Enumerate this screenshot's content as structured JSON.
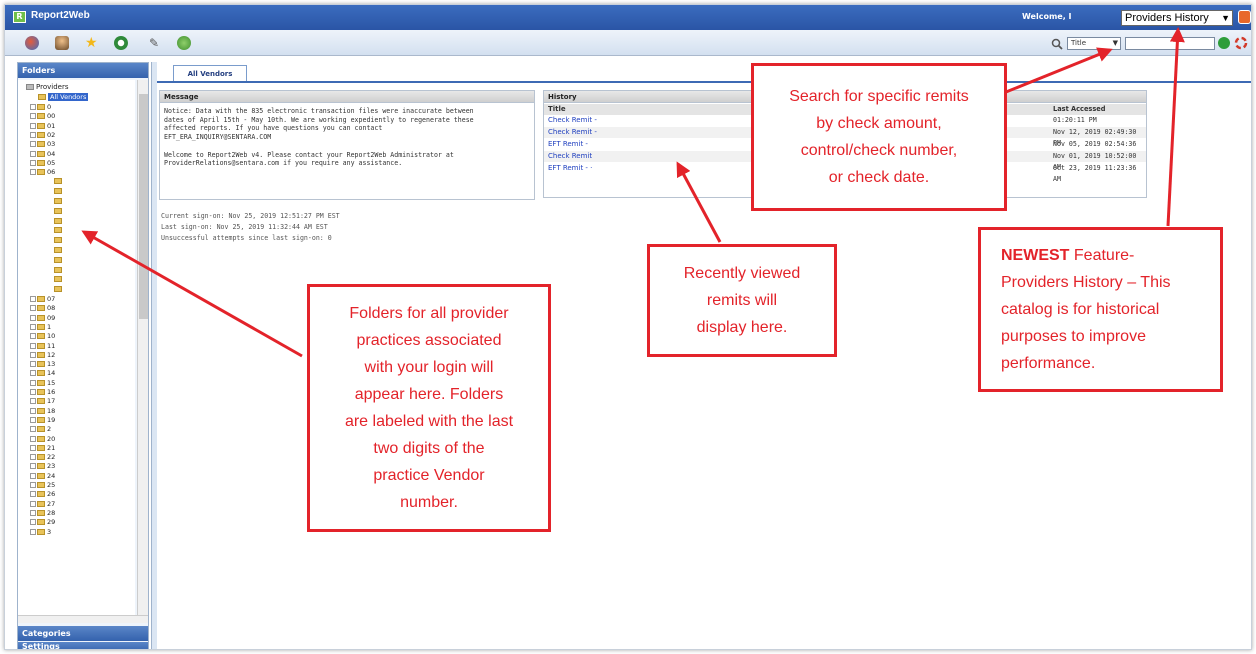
{
  "app": {
    "title": "Report2Web",
    "welcome": "Welcome, I",
    "catalog_select": "Providers History"
  },
  "toolbar": {
    "search_type": "Title",
    "search_value": ""
  },
  "leftpane": {
    "folders_header": "Folders",
    "categories_header": "Categories",
    "settings_header": "Settings",
    "root": "Providers",
    "selected": "All Vendors",
    "folders": [
      "0",
      "00",
      "01",
      "02",
      "03",
      "04",
      "05",
      "06",
      "",
      "",
      "",
      "",
      "",
      "",
      "",
      "",
      "",
      "",
      "",
      "",
      "07",
      "08",
      "09",
      "1",
      "10",
      "11",
      "12",
      "13",
      "14",
      "15",
      "16",
      "17",
      "18",
      "19",
      "2",
      "20",
      "21",
      "22",
      "23",
      "24",
      "25",
      "26",
      "27",
      "28",
      "29",
      "3"
    ]
  },
  "main": {
    "tab_label": "All Vendors",
    "message_header": "Message",
    "message_text": "Notice: Data with the 835 electronic transaction files were inaccurate between\ndates of April 15th - May 10th. We are working expediently to regenerate these\naffected reports. If you have questions you can contact\nEFT_ERA_INQUIRY@SENTARA.COM\n\nWelcome to Report2Web v4. Please contact your Report2Web Administrator at\nProviderRelations@sentara.com if you require any assistance.",
    "signon": [
      "Current sign-on: Nov 25, 2019 12:51:27 PM EST",
      "Last sign-on: Nov 25, 2019 11:32:44 AM EST",
      "Unsuccessful attempts since last sign-on: 0"
    ],
    "history_header": "History",
    "history_col_title": "Title",
    "history_col_accessed": "Last Accessed",
    "history": [
      {
        "title": "Check Remit -",
        "accessed": "01:20:11 PM"
      },
      {
        "title": "Check Remit -",
        "accessed": "Nov 12, 2019 02:49:30 PM"
      },
      {
        "title": "EFT Remit -",
        "accessed": "Nov 05, 2019 02:54:36 PM"
      },
      {
        "title": "Check Remit",
        "accessed": "Nov 01, 2019 10:52:00 AM"
      },
      {
        "title": "EFT Remit - ·",
        "accessed": "Oct 23, 2019 11:23:36 AM"
      }
    ]
  },
  "annotations": {
    "search": "Search for specific remits\nby check amount,\ncontrol/check number,\nor check date.",
    "newest_bold": "NEWEST",
    "newest_rest": " Feature-\nProviders History – This\ncatalog is for historical\npurposes to improve\nperformance.",
    "recent": "Recently viewed\nremits will\ndisplay here.",
    "folders": "Folders for all provider\npractices associated\nwith your login will\nappear here.  Folders\nare labeled with the last\ntwo digits of the\npractice Vendor\nnumber."
  },
  "colors": {
    "annotation_red": "#e3232a",
    "titlebar_blue": "#2a55a6",
    "link_blue": "#1f3fbf"
  }
}
